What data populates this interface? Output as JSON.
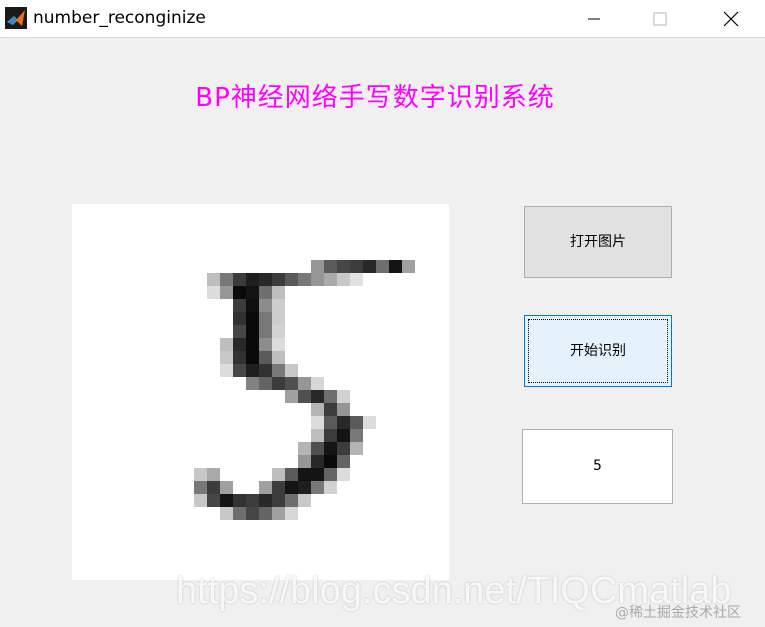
{
  "window": {
    "title": "number_reconginize",
    "app_icon": "matlab-icon",
    "controls": [
      "minimize-icon",
      "maximize-icon",
      "close-icon"
    ]
  },
  "app": {
    "heading": "BP神经网络手写数字识别系统",
    "heading_color": "#ff00ff"
  },
  "image_panel": {
    "content": "handwritten-digit-image"
  },
  "buttons": {
    "open_image": "打开图片",
    "start_recognition": "开始识别"
  },
  "result": {
    "value": "5"
  },
  "watermark": {
    "text": "https://blog.csdn.net/TIQCmatlab",
    "source": "@稀土掘金技术社区"
  },
  "colors": {
    "window_bg": "#f0f0f0",
    "focus_border": "#0078d7",
    "button_bg": "#e1e1e1"
  }
}
